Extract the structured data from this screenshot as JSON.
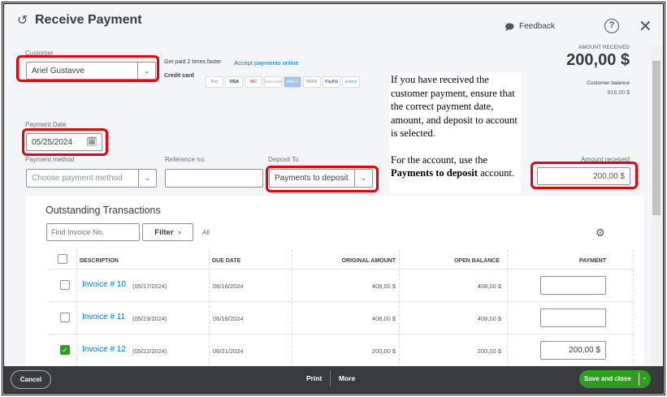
{
  "header": {
    "title": "Receive Payment",
    "feedback": "Feedback",
    "help_icon": "question-circle-icon",
    "close_icon": "x-icon"
  },
  "customer": {
    "label": "Customer",
    "value": "Ariel Gustavve"
  },
  "promo": {
    "text": "Get paid 2 times faster",
    "link": "Accept payments online",
    "credit_card_label": "Credit card",
    "cards": [
      "Pay",
      "VISA",
      "MC",
      "DISCOVER",
      "AMEX",
      "BANK",
      "PayPal",
      "venmo"
    ]
  },
  "amount_summary": {
    "label": "AMOUNT RECEIVED",
    "value": "200,00 $",
    "balance_label": "Customer balance",
    "balance_value": "816,00 $"
  },
  "payment_date": {
    "label": "Payment Date",
    "value": "05/25/2024"
  },
  "payment_method": {
    "label": "Payment method",
    "placeholder": "Choose payment method"
  },
  "reference": {
    "label": "Reference no.",
    "value": ""
  },
  "deposit_to": {
    "label": "Deposit To",
    "value": "Payments to deposit"
  },
  "amount_received": {
    "label": "Amount received",
    "value": "200,00 $"
  },
  "note": {
    "p1": "If you have received the customer payment, ensure that the correct payment date, amount, and deposit to account is selected.",
    "p2_pre": "For the account, use the ",
    "p2_bold": "Payments to deposit",
    "p2_post": " account."
  },
  "outstanding": {
    "title": "Outstanding Transactions",
    "search_placeholder": "Find Invoice No.",
    "filter": "Filter",
    "filter_value": "All",
    "columns": [
      "DESCRIPTION",
      "DUE DATE",
      "ORIGINAL AMOUNT",
      "OPEN BALANCE",
      "PAYMENT"
    ],
    "rows": [
      {
        "invoice": "Invoice # 10",
        "date": "(05/17/2024)",
        "due": "06/16/2024",
        "original": "408,00 $",
        "open": "408,00 $",
        "payment": "",
        "checked": false
      },
      {
        "invoice": "Invoice # 11",
        "date": "(05/19/2024)",
        "due": "06/18/2024",
        "original": "408,00 $",
        "open": "408,00 $",
        "payment": "",
        "checked": false
      },
      {
        "invoice": "Invoice # 12",
        "date": "(05/22/2024)",
        "due": "06/21/2024",
        "original": "200,00 $",
        "open": "200,00 $",
        "payment": "200,00 $",
        "checked": true
      }
    ]
  },
  "footer": {
    "cancel": "Cancel",
    "print": "Print",
    "more": "More",
    "save": "Save and close"
  },
  "colors": {
    "accent_green": "#2ca01c",
    "link_blue": "#0077c5",
    "highlight_red": "#e5000b",
    "footer_bg": "#393a3d"
  }
}
